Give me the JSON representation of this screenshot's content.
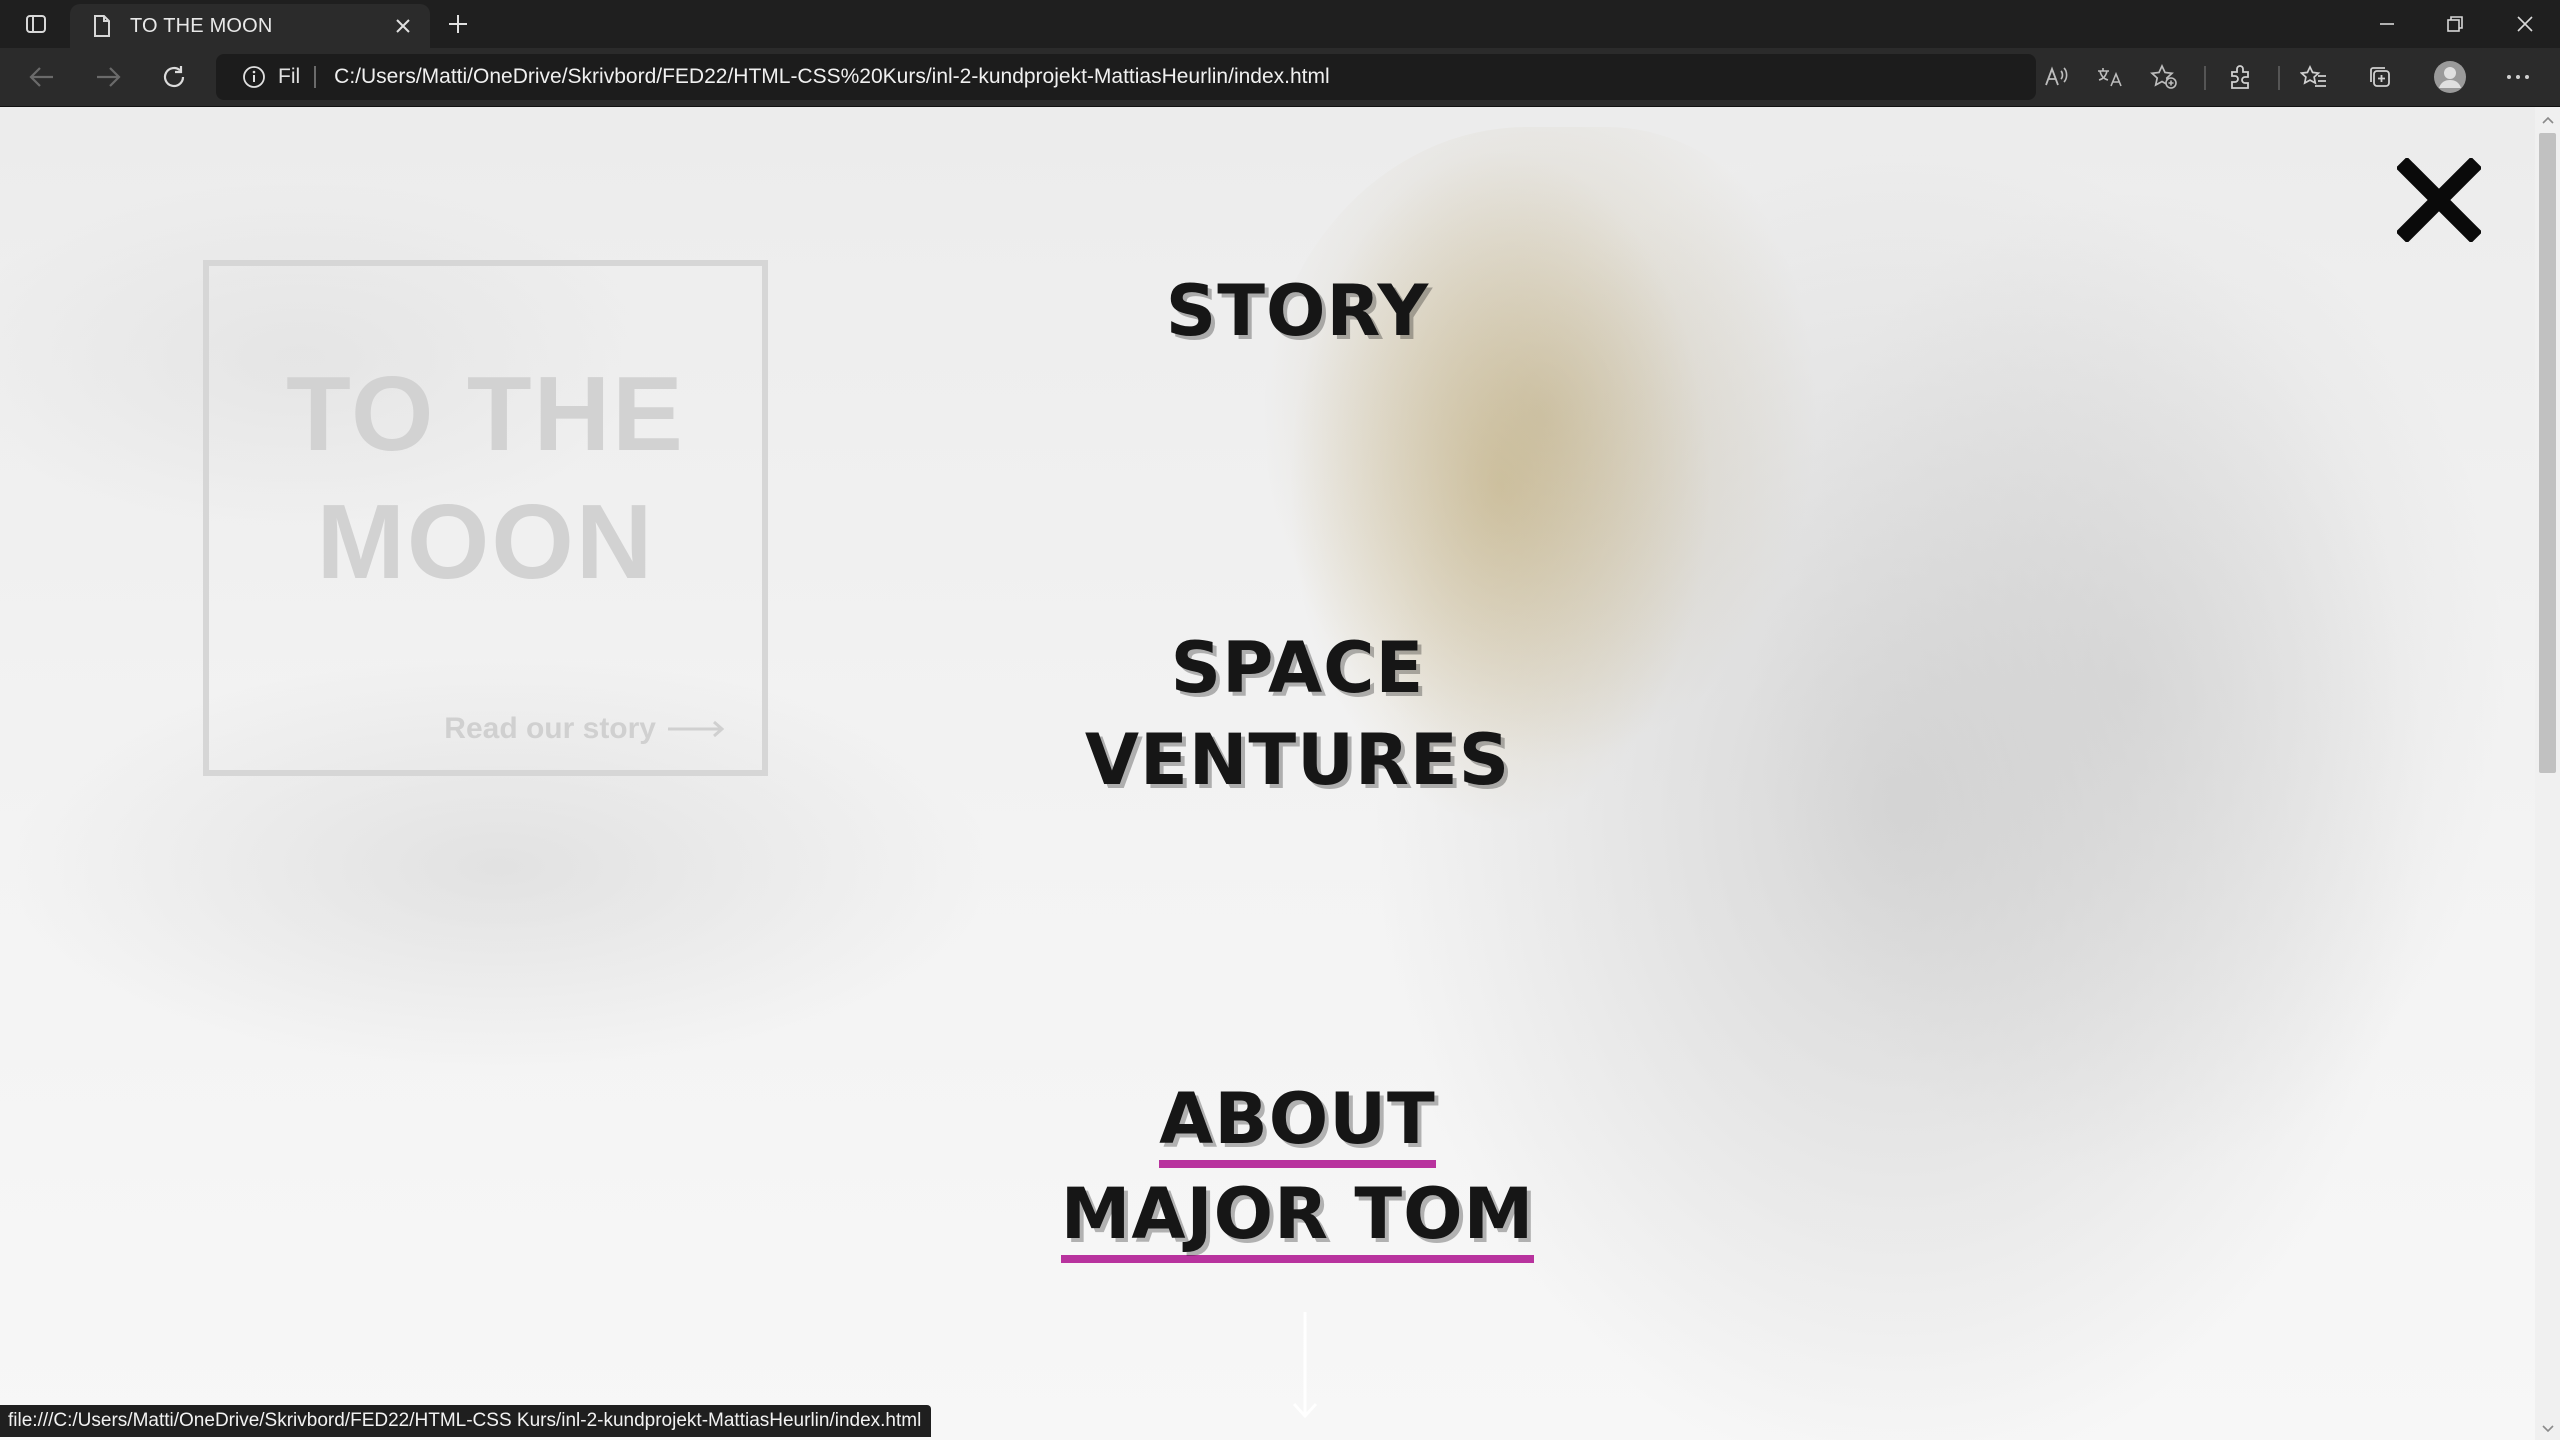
{
  "browser": {
    "tab": {
      "title": "TO THE MOON"
    },
    "address": {
      "scheme_label": "Fil",
      "url": "C:/Users/Matti/OneDrive/Skrivbord/FED22/HTML-CSS%20Kurs/inl-2-kundprojekt-MattiasHeurlin/index.html"
    },
    "status_url": "file:///C:/Users/Matti/OneDrive/Skrivbord/FED22/HTML-CSS Kurs/inl-2-kundprojekt-MattiasHeurlin/index.html"
  },
  "page": {
    "logo": {
      "line1": "TO THE",
      "line2": "MOON",
      "link": "Read our story"
    },
    "menu": [
      {
        "line1": "STORY"
      },
      {
        "line1": "SPACE",
        "line2": "VENTURES"
      },
      {
        "line1": "ABOUT",
        "line2": "MAJOR TOM",
        "active": true
      }
    ]
  },
  "colors": {
    "accent_underline": "#b8339e",
    "menu_text": "#161616",
    "logo_text": "#d2d2d2"
  },
  "icons": [
    "tab-actions-icon",
    "page-icon",
    "close-tab-icon",
    "new-tab-icon",
    "minimize-icon",
    "restore-icon",
    "window-close-icon",
    "back-icon",
    "forward-icon",
    "refresh-icon",
    "info-icon",
    "read-aloud-icon",
    "translate-icon",
    "add-favorite-icon",
    "extensions-icon",
    "favorites-icon",
    "collections-icon",
    "profile-icon",
    "more-icon",
    "close-menu-icon",
    "arrow-right-icon",
    "scroll-down-arrow-icon"
  ]
}
